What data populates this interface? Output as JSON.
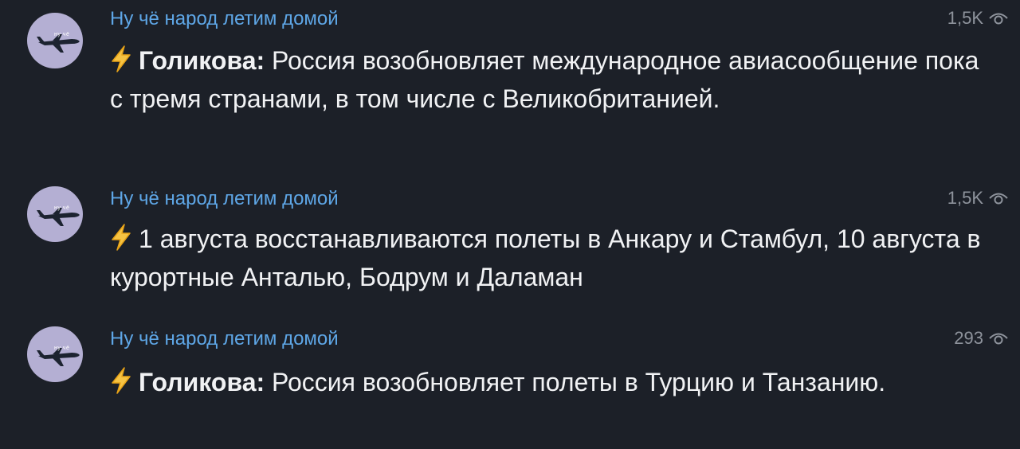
{
  "messages": [
    {
      "channel": "Ну чё народ летим домой",
      "avatar_tag": "ну чё",
      "views": "1,5K",
      "bold": "Голикова:",
      "text": " Россия возобновляет международное авиасообщение пока с тремя странами, в том числе с Великобританией."
    },
    {
      "channel": "Ну чё народ летим домой",
      "avatar_tag": "ну чё",
      "views": "1,5K",
      "bold": "",
      "text": "1 августа восстанавливаются полеты в Анкару и Стамбул, 10 августа в курортные Анталью, Бодрум и Даламан"
    },
    {
      "channel": "Ну чё народ летим домой",
      "avatar_tag": "ну чё",
      "views": "293",
      "bold": "Голикова:",
      "text": " Россия возобновляет полеты в Турцию и Танзанию."
    }
  ],
  "icons": {
    "avatar": "airplane-icon",
    "views": "eye-icon",
    "prefix": "lightning-bolt-icon"
  },
  "colors": {
    "background": "#1c2028",
    "channel_name": "#5ea6e6",
    "text": "#f1f2f4",
    "views": "#8e939c",
    "avatar_bg": "#b4afd3",
    "bolt_fill": "#f6c343",
    "bolt_outline": "#e8a317"
  }
}
